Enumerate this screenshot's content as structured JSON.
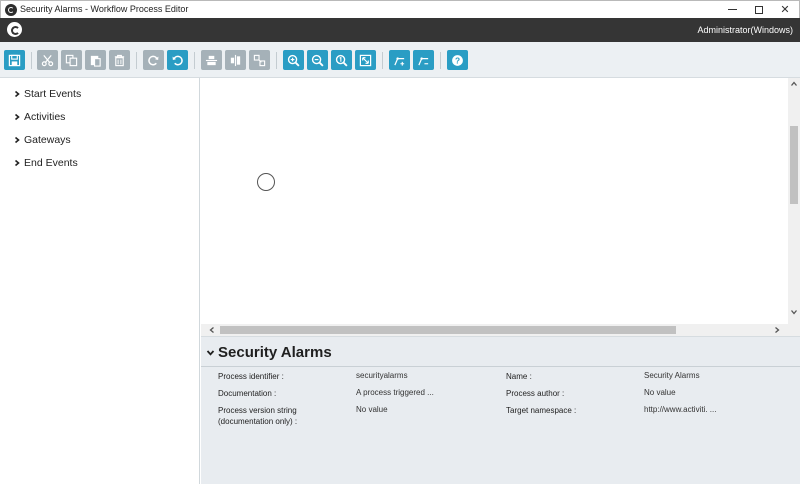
{
  "window": {
    "title": "Security Alarms - Workflow Process Editor"
  },
  "header": {
    "user": "Administrator(Windows)"
  },
  "toolbar": {
    "buttons": [
      {
        "name": "save-icon",
        "style": "blue"
      },
      {
        "name": "cut-icon",
        "style": "gray"
      },
      {
        "name": "copy-icon",
        "style": "gray"
      },
      {
        "name": "paste-icon",
        "style": "gray"
      },
      {
        "name": "delete-icon",
        "style": "gray"
      },
      {
        "name": "redo-icon",
        "style": "gray"
      },
      {
        "name": "undo-icon",
        "style": "blue"
      },
      {
        "name": "align-icon",
        "style": "gray"
      },
      {
        "name": "distribute-icon",
        "style": "gray"
      },
      {
        "name": "resize-icon",
        "style": "gray"
      },
      {
        "name": "zoom-in-icon",
        "style": "blue"
      },
      {
        "name": "zoom-out-icon",
        "style": "blue"
      },
      {
        "name": "zoom-actual-icon",
        "style": "blue"
      },
      {
        "name": "zoom-fit-icon",
        "style": "blue"
      },
      {
        "name": "add-bendpoint-icon",
        "style": "blue"
      },
      {
        "name": "remove-bendpoint-icon",
        "style": "blue"
      },
      {
        "name": "help-icon",
        "style": "blue"
      }
    ]
  },
  "palette": {
    "items": [
      {
        "label": "Start Events"
      },
      {
        "label": "Activities"
      },
      {
        "label": "Gateways"
      },
      {
        "label": "End Events"
      }
    ]
  },
  "properties": {
    "heading": "Security Alarms",
    "process_identifier_label": "Process identifier :",
    "process_identifier_value": "securityalarms",
    "name_label": "Name :",
    "name_value": "Security Alarms",
    "documentation_label": "Documentation :",
    "documentation_value": "A process triggered ...",
    "process_author_label": "Process author :",
    "process_author_value": "No value",
    "version_label": "Process version string (documentation only) :",
    "version_value": "No value",
    "target_namespace_label": "Target namespace :",
    "target_namespace_value": "http://www.activiti. ..."
  },
  "colors": {
    "accent_blue": "#2a9dc4",
    "disabled_gray": "#a5b1b8",
    "header_dark": "#353535"
  }
}
